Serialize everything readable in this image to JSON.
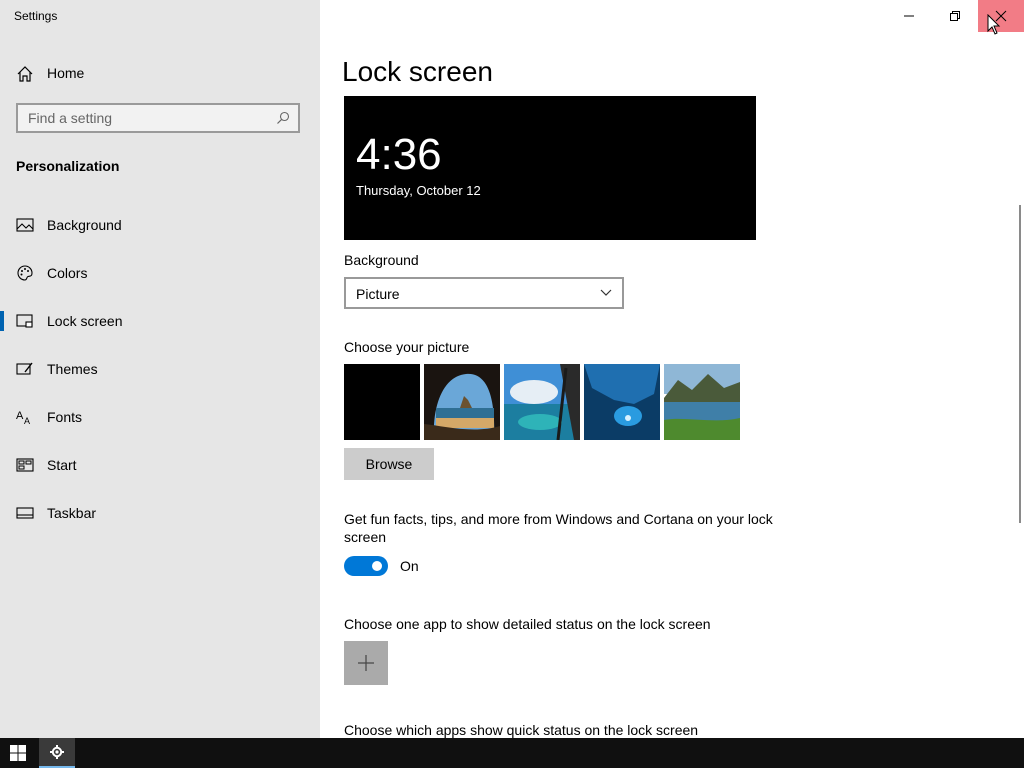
{
  "window": {
    "title": "Settings"
  },
  "sidebar": {
    "home_label": "Home",
    "search_placeholder": "Find a setting",
    "section_title": "Personalization",
    "items": [
      {
        "label": "Background",
        "icon": "picture-icon",
        "active": false
      },
      {
        "label": "Colors",
        "icon": "palette-icon",
        "active": false
      },
      {
        "label": "Lock screen",
        "icon": "lock-screen-icon",
        "active": true
      },
      {
        "label": "Themes",
        "icon": "themes-icon",
        "active": false
      },
      {
        "label": "Fonts",
        "icon": "fonts-icon",
        "active": false
      },
      {
        "label": "Start",
        "icon": "start-icon",
        "active": false
      },
      {
        "label": "Taskbar",
        "icon": "taskbar-icon",
        "active": false
      }
    ]
  },
  "main": {
    "title": "Lock screen",
    "preview": {
      "time": "4:36",
      "date": "Thursday, October 12"
    },
    "background_label": "Background",
    "background_value": "Picture",
    "choose_picture_label": "Choose your picture",
    "browse_label": "Browse",
    "fun_facts_text": "Get fun facts, tips, and more from Windows and Cortana on your lock screen",
    "toggle_state": "On",
    "detailed_status_label": "Choose one app to show detailed status on the lock screen",
    "quick_status_label": "Choose which apps show quick status on the lock screen"
  },
  "colors": {
    "accent": "#0078d7",
    "sidebar_bg": "#e6e6e6",
    "taskbar_bg": "#101010",
    "close_hover": "#e81123"
  }
}
